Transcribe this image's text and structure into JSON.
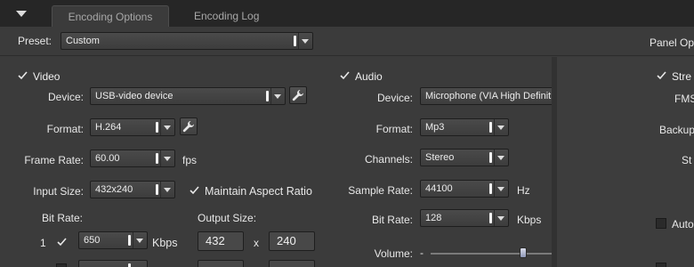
{
  "tabs": [
    {
      "label": "Encoding Options",
      "active": true
    },
    {
      "label": "Encoding Log",
      "active": false
    }
  ],
  "preset": {
    "label": "Preset:",
    "value": "Custom"
  },
  "panel_options_label": "Panel Op",
  "video": {
    "header": "Video",
    "enabled": true,
    "device": {
      "label": "Device:",
      "value": "USB-video device"
    },
    "format": {
      "label": "Format:",
      "value": "H.264"
    },
    "frame_rate": {
      "label": "Frame Rate:",
      "value": "60.00",
      "unit": "fps"
    },
    "input_size": {
      "label": "Input Size:",
      "value": "432x240"
    },
    "maintain_aspect": {
      "label": "Maintain Aspect Ratio",
      "checked": true
    },
    "bit_rate_label": "Bit Rate:",
    "output_size_label": "Output Size:",
    "rows": [
      {
        "index": "1",
        "enabled": true,
        "bitrate": "650",
        "unit": "Kbps",
        "width": "432",
        "x": "x",
        "height": "240"
      }
    ]
  },
  "audio": {
    "header": "Audio",
    "enabled": true,
    "device": {
      "label": "Device:",
      "value": "Microphone (VIA High Definition A"
    },
    "format": {
      "label": "Format:",
      "value": "Mp3"
    },
    "channels": {
      "label": "Channels:",
      "value": "Stereo"
    },
    "sample_rate": {
      "label": "Sample Rate:",
      "value": "44100",
      "unit": "Hz"
    },
    "bit_rate": {
      "label": "Bit Rate:",
      "value": "128",
      "unit": "Kbps"
    },
    "volume": {
      "label": "Volume:",
      "minus": "-",
      "plus": "+",
      "level": 0.5
    }
  },
  "right_panel": {
    "stream_label": "Stre",
    "fms_label": "FMS",
    "backup_label": "Backup",
    "st_label": "St",
    "auto_label": "Auto"
  },
  "colors": {
    "background": "#3b3b3b",
    "topbar": "#262626",
    "text": "#e6e6e6"
  }
}
